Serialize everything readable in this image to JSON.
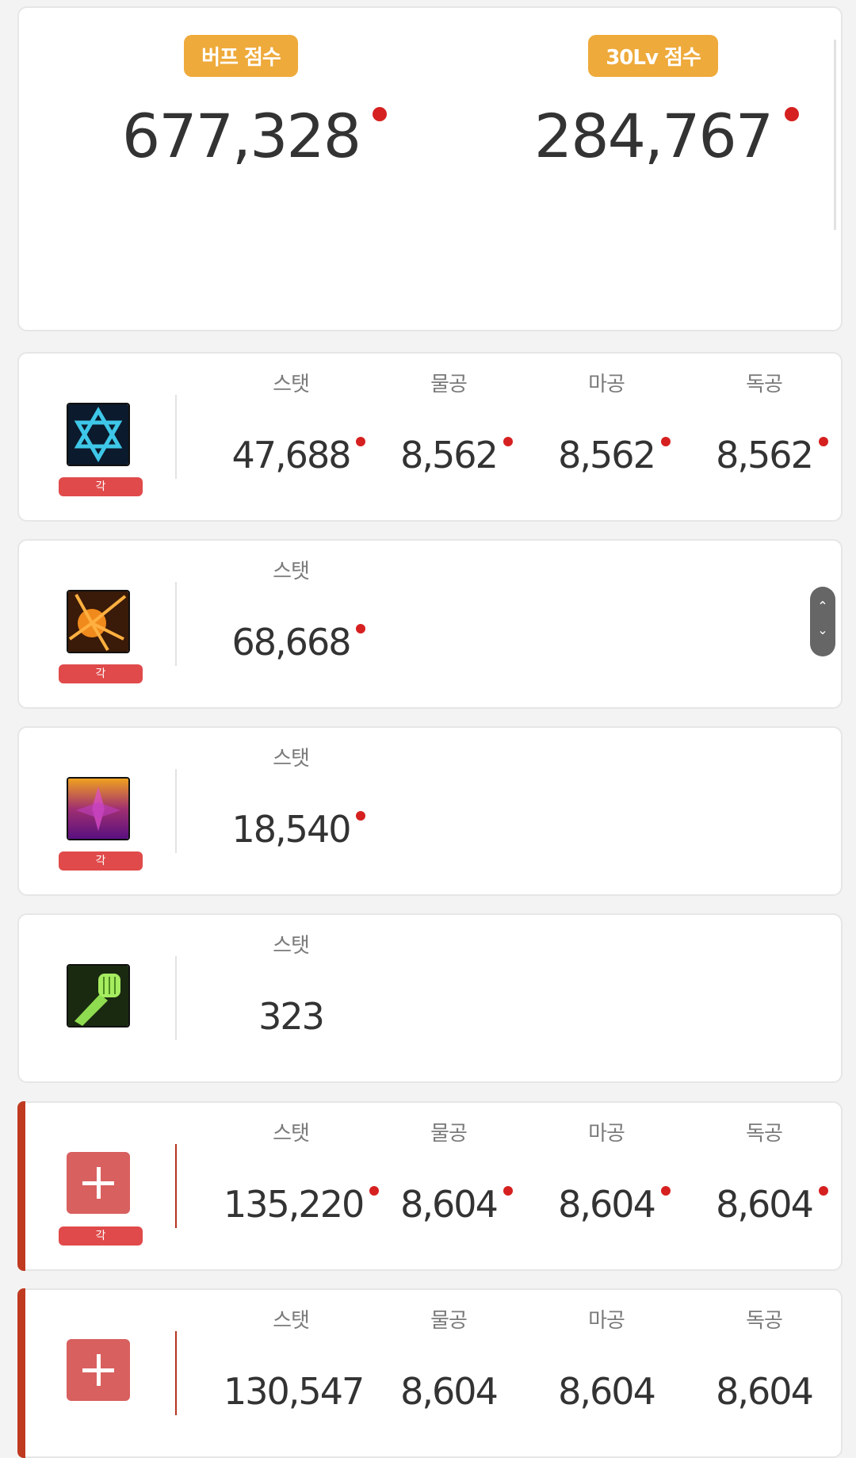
{
  "summary": {
    "buff_score": {
      "label": "버프 점수",
      "value": "677,328"
    },
    "lv30_score": {
      "label": "30Lv 점수",
      "value": "284,767"
    }
  },
  "badge_label": "각",
  "rows": [
    {
      "icon": "hexagram-icon",
      "stats": [
        {
          "label": "스탯",
          "value": "47,688"
        },
        {
          "label": "물공",
          "value": "8,562"
        },
        {
          "label": "마공",
          "value": "8,562"
        },
        {
          "label": "독공",
          "value": "8,562"
        }
      ]
    },
    {
      "icon": "sunburst-skill-icon",
      "stats": [
        {
          "label": "스탯",
          "value": "68,668"
        }
      ]
    },
    {
      "icon": "purple-flame-skill-icon",
      "stats": [
        {
          "label": "스탯",
          "value": "18,540"
        }
      ]
    },
    {
      "icon": "green-fist-icon",
      "stats": [
        {
          "label": "스탯",
          "value": "323"
        }
      ]
    },
    {
      "icon": "plus-icon",
      "stats": [
        {
          "label": "스탯",
          "value": "135,220"
        },
        {
          "label": "물공",
          "value": "8,604"
        },
        {
          "label": "마공",
          "value": "8,604"
        },
        {
          "label": "독공",
          "value": "8,604"
        }
      ]
    },
    {
      "icon": "plus-icon",
      "stats": [
        {
          "label": "스탯",
          "value": "130,547"
        },
        {
          "label": "물공",
          "value": "8,604"
        },
        {
          "label": "마공",
          "value": "8,604"
        },
        {
          "label": "독공",
          "value": "8,604"
        }
      ]
    }
  ],
  "colors": {
    "score_pill": "#eeaa3b",
    "badge": "#e04a4a",
    "dot": "#d62020",
    "accent": "#c03a20"
  }
}
